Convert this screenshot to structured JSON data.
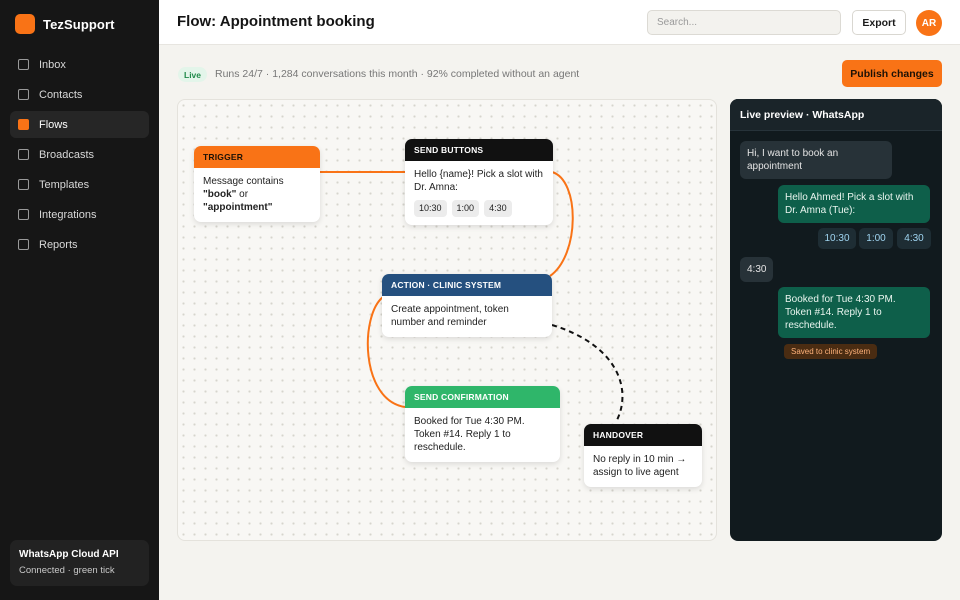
{
  "app": {
    "name": "TezSupport"
  },
  "sidebar": {
    "items": [
      {
        "label": "Inbox",
        "active": false
      },
      {
        "label": "Contacts",
        "active": false
      },
      {
        "label": "Flows",
        "active": true
      },
      {
        "label": "Broadcasts",
        "active": false
      },
      {
        "label": "Templates",
        "active": false
      },
      {
        "label": "Integrations",
        "active": false
      },
      {
        "label": "Reports",
        "active": false
      }
    ],
    "footer": {
      "title": "WhatsApp Cloud API",
      "subtitle": "Connected · green tick"
    }
  },
  "header": {
    "title": "Flow: Appointment booking",
    "search_placeholder": "Search...",
    "export_label": "Export",
    "avatar_initials": "AR"
  },
  "status": {
    "badge": "Live",
    "text": "Runs 24/7 · 1,284 conversations this month · 92% completed without an agent",
    "publish_label": "Publish changes"
  },
  "nodes": {
    "trigger": {
      "header": "TRIGGER",
      "line1": "Message contains",
      "kw1": "\"book\"",
      "or": " or",
      "kw2": "\"appointment\""
    },
    "send_buttons": {
      "header": "SEND BUTTONS",
      "text": "Hello {name}! Pick a slot with Dr. Amna:",
      "chips": [
        "10:30",
        "1:00",
        "4:30"
      ]
    },
    "action": {
      "header": "ACTION · CLINIC SYSTEM",
      "text": "Create appointment, token number and reminder"
    },
    "confirmation": {
      "header": "SEND CONFIRMATION",
      "text": "Booked for Tue 4:30 PM. Token #14. Reply 1 to reschedule."
    },
    "handover": {
      "header": "HANDOVER",
      "text": "No reply in 10 min → assign to live agent"
    }
  },
  "preview": {
    "title": "Live preview · WhatsApp",
    "messages": [
      {
        "dir": "in",
        "text": "Hi, I want to book an appointment"
      },
      {
        "dir": "out",
        "text": "Hello Ahmed! Pick a slot with Dr. Amna (Tue):"
      },
      {
        "dir": "in",
        "text": "4:30"
      },
      {
        "dir": "out",
        "text": "Booked for Tue 4:30 PM. Token #14. Reply 1 to reschedule."
      }
    ],
    "reply_chips": [
      "10:30",
      "1:00",
      "4:30"
    ],
    "saved_tag": "Saved to clinic system"
  },
  "colors": {
    "accent": "#f97316",
    "trigger": "#f97316",
    "send_buttons": "#111111",
    "action": "#25507f",
    "confirmation": "#2fb66a",
    "handover": "#111111"
  }
}
